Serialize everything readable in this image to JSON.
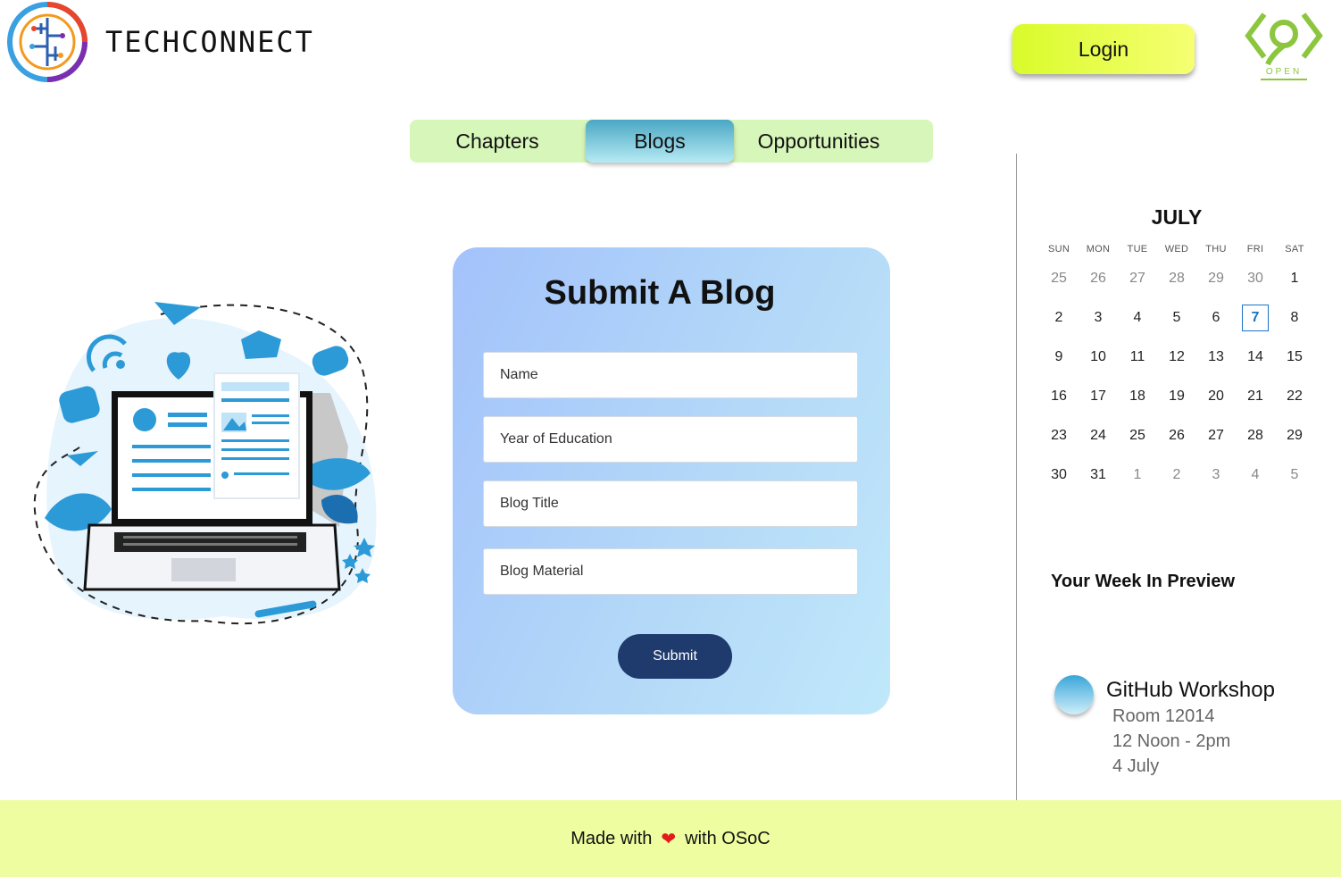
{
  "header": {
    "brand": "TECHCONNECT",
    "login_label": "Login",
    "logo_icon": "circuit-brain-logo",
    "partner_logo_icon": "osoc-open-logo",
    "partner_logo_text": "OPEN"
  },
  "tabs": [
    {
      "label": "Chapters",
      "active": false
    },
    {
      "label": "Blogs",
      "active": true
    },
    {
      "label": "Opportunities",
      "active": false
    }
  ],
  "form": {
    "title": "Submit A Blog",
    "fields": {
      "name_placeholder": "Name",
      "year_placeholder": "Year of Education",
      "title_placeholder": "Blog Title",
      "material_placeholder": "Blog Material"
    },
    "submit_label": "Submit"
  },
  "calendar": {
    "month": "JULY",
    "weekdays": [
      "SUN",
      "MON",
      "TUE",
      "WED",
      "THU",
      "FRI",
      "SAT"
    ],
    "weeks": [
      [
        "25",
        "26",
        "27",
        "28",
        "29",
        "30",
        "1"
      ],
      [
        "2",
        "3",
        "4",
        "5",
        "6",
        "7",
        "8"
      ],
      [
        "9",
        "10",
        "11",
        "12",
        "13",
        "14",
        "15"
      ],
      [
        "16",
        "17",
        "18",
        "19",
        "20",
        "21",
        "22"
      ],
      [
        "23",
        "24",
        "25",
        "26",
        "27",
        "28",
        "29"
      ],
      [
        "30",
        "31",
        "1",
        "2",
        "3",
        "4",
        "5"
      ]
    ],
    "selected_day": "7",
    "accent_color": "#1a73c8"
  },
  "preview": {
    "title": "Your Week In Preview",
    "event": {
      "name": "GitHub Workshop",
      "room": "Room 12014",
      "time": "12 Noon - 2pm",
      "date": "4 July"
    }
  },
  "footer": {
    "prefix": "Made with",
    "heart": "❤",
    "suffix": "with OSoC"
  },
  "colors": {
    "login_button": "#d9fb2a",
    "tab_bar": "#d7f6b9",
    "active_tab": "#4aa7c4",
    "submit_button": "#1f3a6c",
    "footer": "#edfd9f"
  }
}
